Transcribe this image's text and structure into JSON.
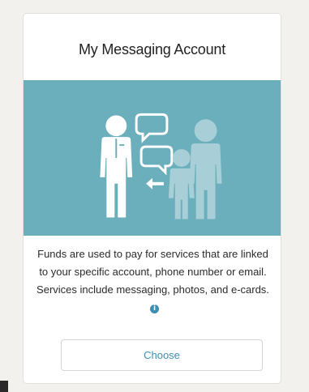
{
  "card": {
    "title": "My Messaging Account",
    "description": "Funds are used to pay for services that are linked to your specific account, phone number or email. Services include messaging, photos, and e-cards.",
    "info_icon_glyph": "i",
    "choose_label": "Choose"
  },
  "colors": {
    "banner": "#6aafbb",
    "accent": "#3a90b7",
    "page_background": "#f3f1ed"
  },
  "icons": {
    "banner_illustration": "staff-and-family-messaging-illustration",
    "info": "info-icon"
  }
}
